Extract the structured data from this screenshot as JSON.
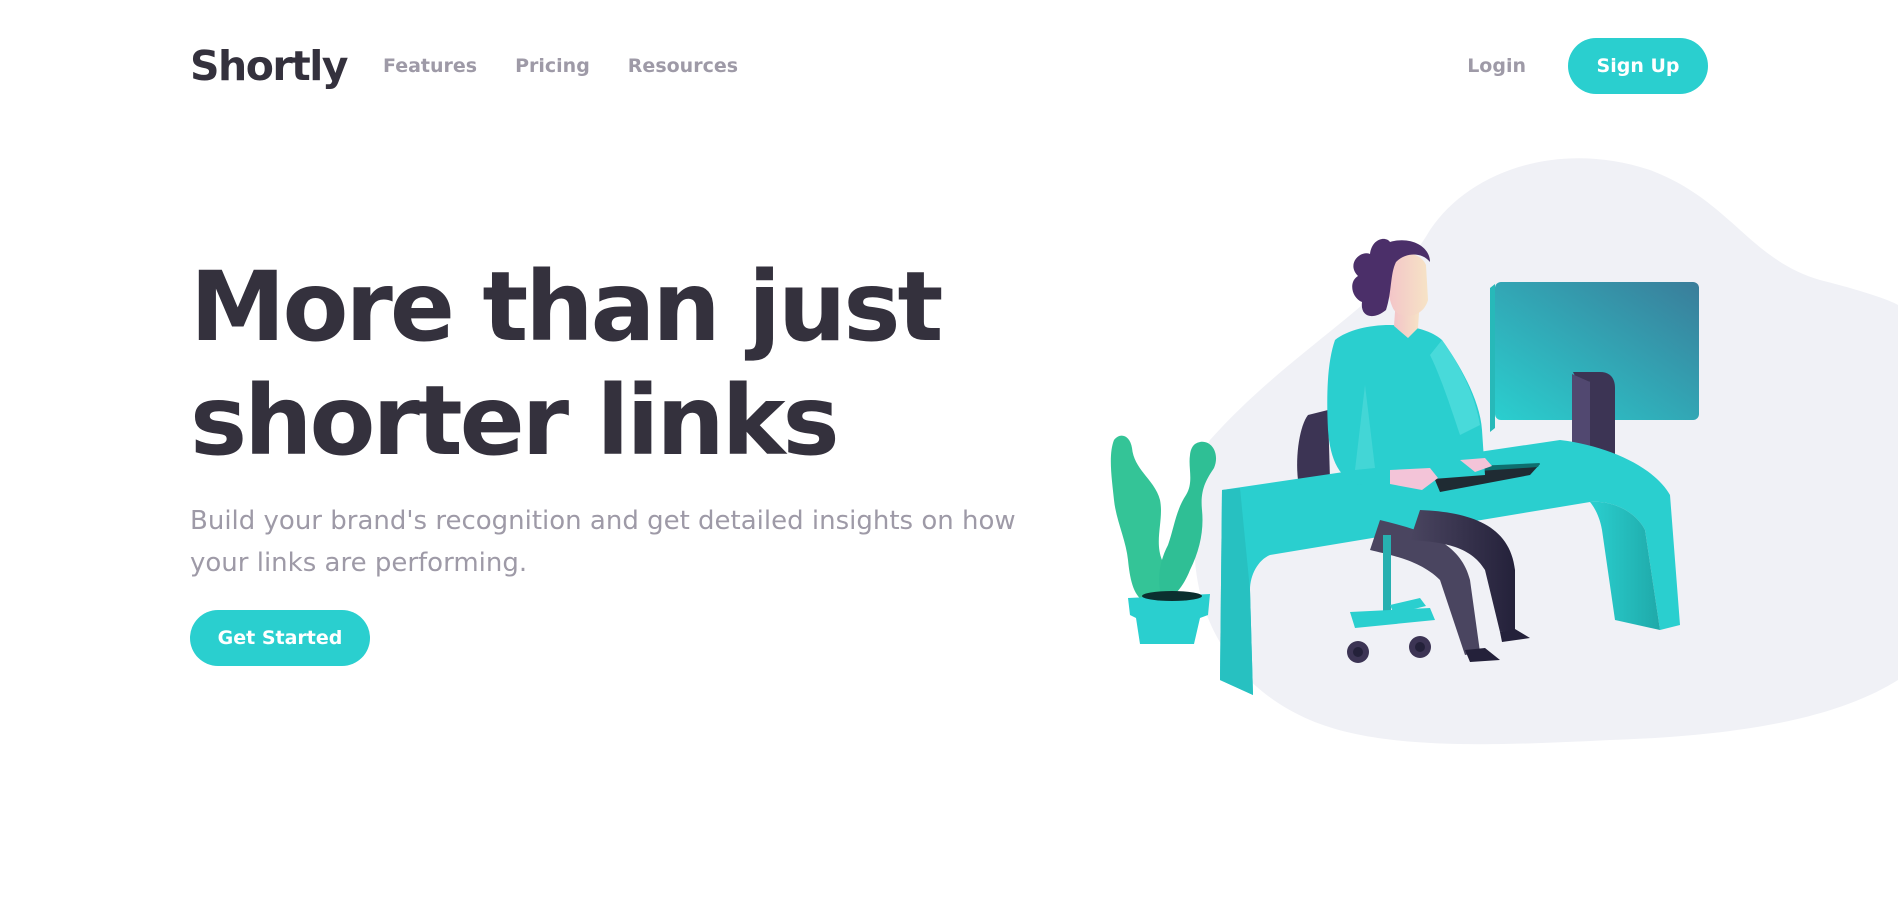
{
  "brand": {
    "logo": "Shortly"
  },
  "nav": {
    "items": [
      {
        "label": "Features"
      },
      {
        "label": "Pricing"
      },
      {
        "label": "Resources"
      }
    ],
    "login_label": "Login",
    "signup_label": "Sign Up"
  },
  "hero": {
    "title_line1": "More than just",
    "title_line2": "shorter links",
    "subtitle": "Build your brand's recognition and get detailed insights on how your links are performing.",
    "cta_label": "Get Started",
    "illustration_icon": "person-working-at-desk-illustration"
  },
  "colors": {
    "accent": "#2acfcf",
    "dark_text": "#34313d",
    "muted_text": "#9e9aa7",
    "blob_bg": "#f0f1f6",
    "plant": "#34c497",
    "hair": "#4b2f69"
  }
}
